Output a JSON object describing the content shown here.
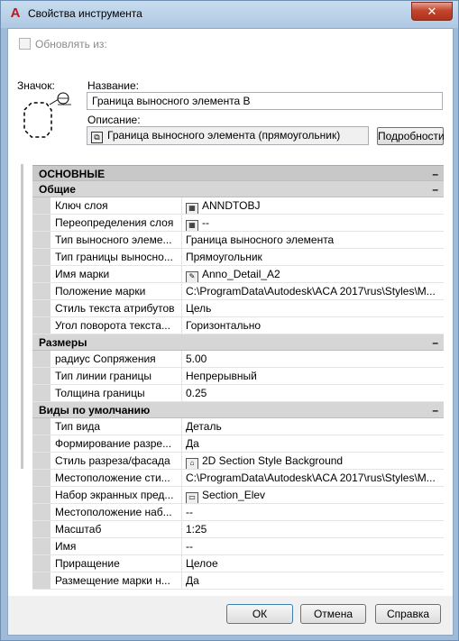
{
  "window": {
    "title": "Свойства инструмента",
    "close_label": "✕"
  },
  "update_from": {
    "label": "Обновлять из:"
  },
  "icon_label": "Значок:",
  "name": {
    "label": "Название:",
    "value": "Граница выносного элемента В"
  },
  "description": {
    "label": "Описание:",
    "value": "Граница выносного элемента (прямоугольник)",
    "details_label": "Подробности"
  },
  "sections": {
    "main": {
      "title": "ОСНОВНЫЕ",
      "toggle": "–"
    },
    "general": {
      "title": "Общие",
      "toggle": "–",
      "rows": [
        {
          "name": "Ключ слоя",
          "value": "ANNDTOBJ",
          "icon": "table-icon"
        },
        {
          "name": "Переопределения слоя",
          "value": "--",
          "icon": "table-icon"
        },
        {
          "name": "Тип выносного элеме...",
          "value": "Граница выносного элемента"
        },
        {
          "name": "Тип границы выносно...",
          "value": "Прямоугольник"
        },
        {
          "name": "Имя марки",
          "value": "Anno_Detail_A2",
          "icon": "drawing-icon"
        },
        {
          "name": "Положение марки",
          "value": "C:\\ProgramData\\Autodesk\\ACA  2017\\rus\\Styles\\M..."
        },
        {
          "name": "Стиль текста атрибутов",
          "value": "Цель"
        },
        {
          "name": "Угол поворота текста...",
          "value": "Горизонтально"
        }
      ]
    },
    "dimensions": {
      "title": "Размеры",
      "toggle": "–",
      "rows": [
        {
          "name": "радиус Сопряжения",
          "value": "5.00"
        },
        {
          "name": "Тип линии границы",
          "value": "Непрерывный"
        },
        {
          "name": "Толщина границы",
          "value": "0.25"
        }
      ]
    },
    "default_views": {
      "title": "Виды по умолчанию",
      "toggle": "–",
      "rows": [
        {
          "name": "Тип вида",
          "value": "Деталь"
        },
        {
          "name": "Формирование  разре...",
          "value": "Да"
        },
        {
          "name": "Стиль разреза/фасада",
          "value": "2D Section Style Background",
          "icon": "house-icon"
        },
        {
          "name": "Местоположение  сти...",
          "value": "C:\\ProgramData\\Autodesk\\ACA  2017\\rus\\Styles\\M..."
        },
        {
          "name": "Набор экранных пред...",
          "value": "Section_Elev",
          "icon": "display-set-icon"
        },
        {
          "name": "Местоположение  наб...",
          "value": "--"
        },
        {
          "name": "Масштаб",
          "value": "1:25"
        },
        {
          "name": "Имя",
          "value": "--"
        },
        {
          "name": "Приращение",
          "value": "Целое"
        },
        {
          "name": "Размещение  марки  н...",
          "value": "Да"
        }
      ]
    }
  },
  "buttons": {
    "ok": "ОК",
    "cancel": "Отмена",
    "help": "Справка"
  }
}
